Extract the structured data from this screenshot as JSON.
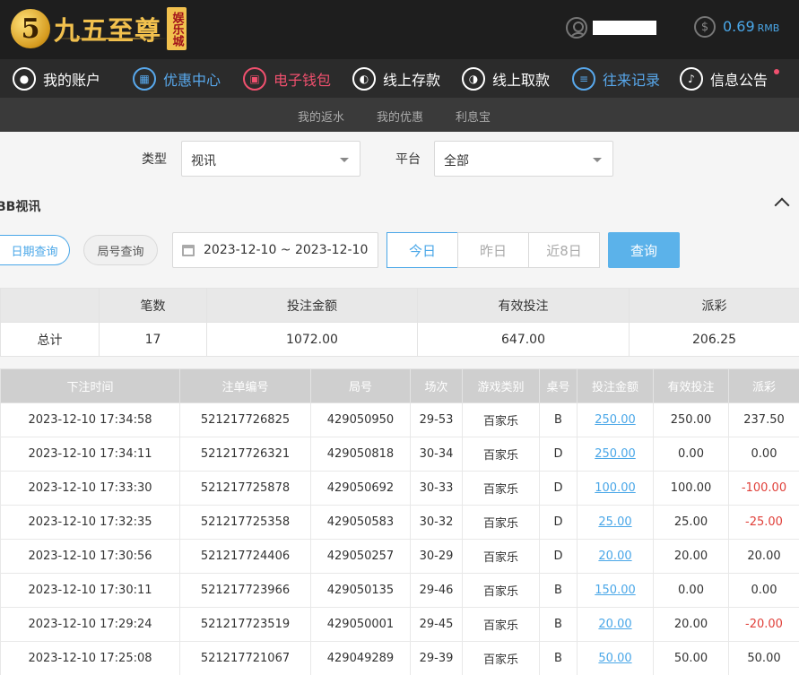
{
  "header": {
    "logo_badge": "5",
    "logo_text": "九五至尊",
    "logo_seal": "娱乐城",
    "balance": "0.69",
    "currency": "RMB"
  },
  "nav": [
    {
      "label": "我的账户",
      "icon": "user-icon",
      "color": "white"
    },
    {
      "label": "优惠中心",
      "icon": "gift-icon",
      "color": "blue"
    },
    {
      "label": "电子钱包",
      "icon": "wallet-icon",
      "color": "red"
    },
    {
      "label": "线上存款",
      "icon": "deposit-icon",
      "color": "white"
    },
    {
      "label": "线上取款",
      "icon": "withdraw-icon",
      "color": "white"
    },
    {
      "label": "往来记录",
      "icon": "records-icon",
      "color": "blue"
    },
    {
      "label": "信息公告",
      "icon": "bell-icon",
      "color": "white"
    }
  ],
  "subnav": [
    "我的返水",
    "我的优惠",
    "利息宝"
  ],
  "filters": {
    "type_label": "类型",
    "type_value": "视讯",
    "platform_label": "平台",
    "platform_value": "全部"
  },
  "section_title": "BB视讯",
  "query": {
    "date_query": "日期查询",
    "round_query": "局号查询",
    "date_range": "2023-12-10 ~ 2023-12-10",
    "today": "今日",
    "yesterday": "昨日",
    "last8": "近8日",
    "submit": "查询"
  },
  "summary": {
    "headers": [
      "",
      "笔数",
      "投注金额",
      "有效投注",
      "派彩"
    ],
    "row": [
      "总计",
      "17",
      "1072.00",
      "647.00",
      "206.25"
    ]
  },
  "detail": {
    "headers": [
      "下注时间",
      "注单编号",
      "局号",
      "场次",
      "游戏类别",
      "桌号",
      "投注金额",
      "有效投注",
      "派彩"
    ],
    "rows": [
      [
        "2023-12-10 17:34:58",
        "521217726825",
        "429050950",
        "29-53",
        "百家乐",
        "B",
        "250.00",
        "250.00",
        "237.50"
      ],
      [
        "2023-12-10 17:34:11",
        "521217726321",
        "429050818",
        "30-34",
        "百家乐",
        "D",
        "250.00",
        "0.00",
        "0.00"
      ],
      [
        "2023-12-10 17:33:30",
        "521217725878",
        "429050692",
        "30-33",
        "百家乐",
        "D",
        "100.00",
        "100.00",
        "-100.00"
      ],
      [
        "2023-12-10 17:32:35",
        "521217725358",
        "429050583",
        "30-32",
        "百家乐",
        "D",
        "25.00",
        "25.00",
        "-25.00"
      ],
      [
        "2023-12-10 17:30:56",
        "521217724406",
        "429050257",
        "30-29",
        "百家乐",
        "D",
        "20.00",
        "20.00",
        "20.00"
      ],
      [
        "2023-12-10 17:30:11",
        "521217723966",
        "429050135",
        "29-46",
        "百家乐",
        "B",
        "150.00",
        "0.00",
        "0.00"
      ],
      [
        "2023-12-10 17:29:24",
        "521217723519",
        "429050001",
        "29-45",
        "百家乐",
        "B",
        "20.00",
        "20.00",
        "-20.00"
      ],
      [
        "2023-12-10 17:25:08",
        "521217721067",
        "429049289",
        "29-39",
        "百家乐",
        "B",
        "50.00",
        "50.00",
        "50.00"
      ]
    ]
  },
  "colors": {
    "accent": "#4aa7e8",
    "negative": "#e0403a",
    "nav_red": "#f0506e",
    "gold": "#f2c14e"
  }
}
